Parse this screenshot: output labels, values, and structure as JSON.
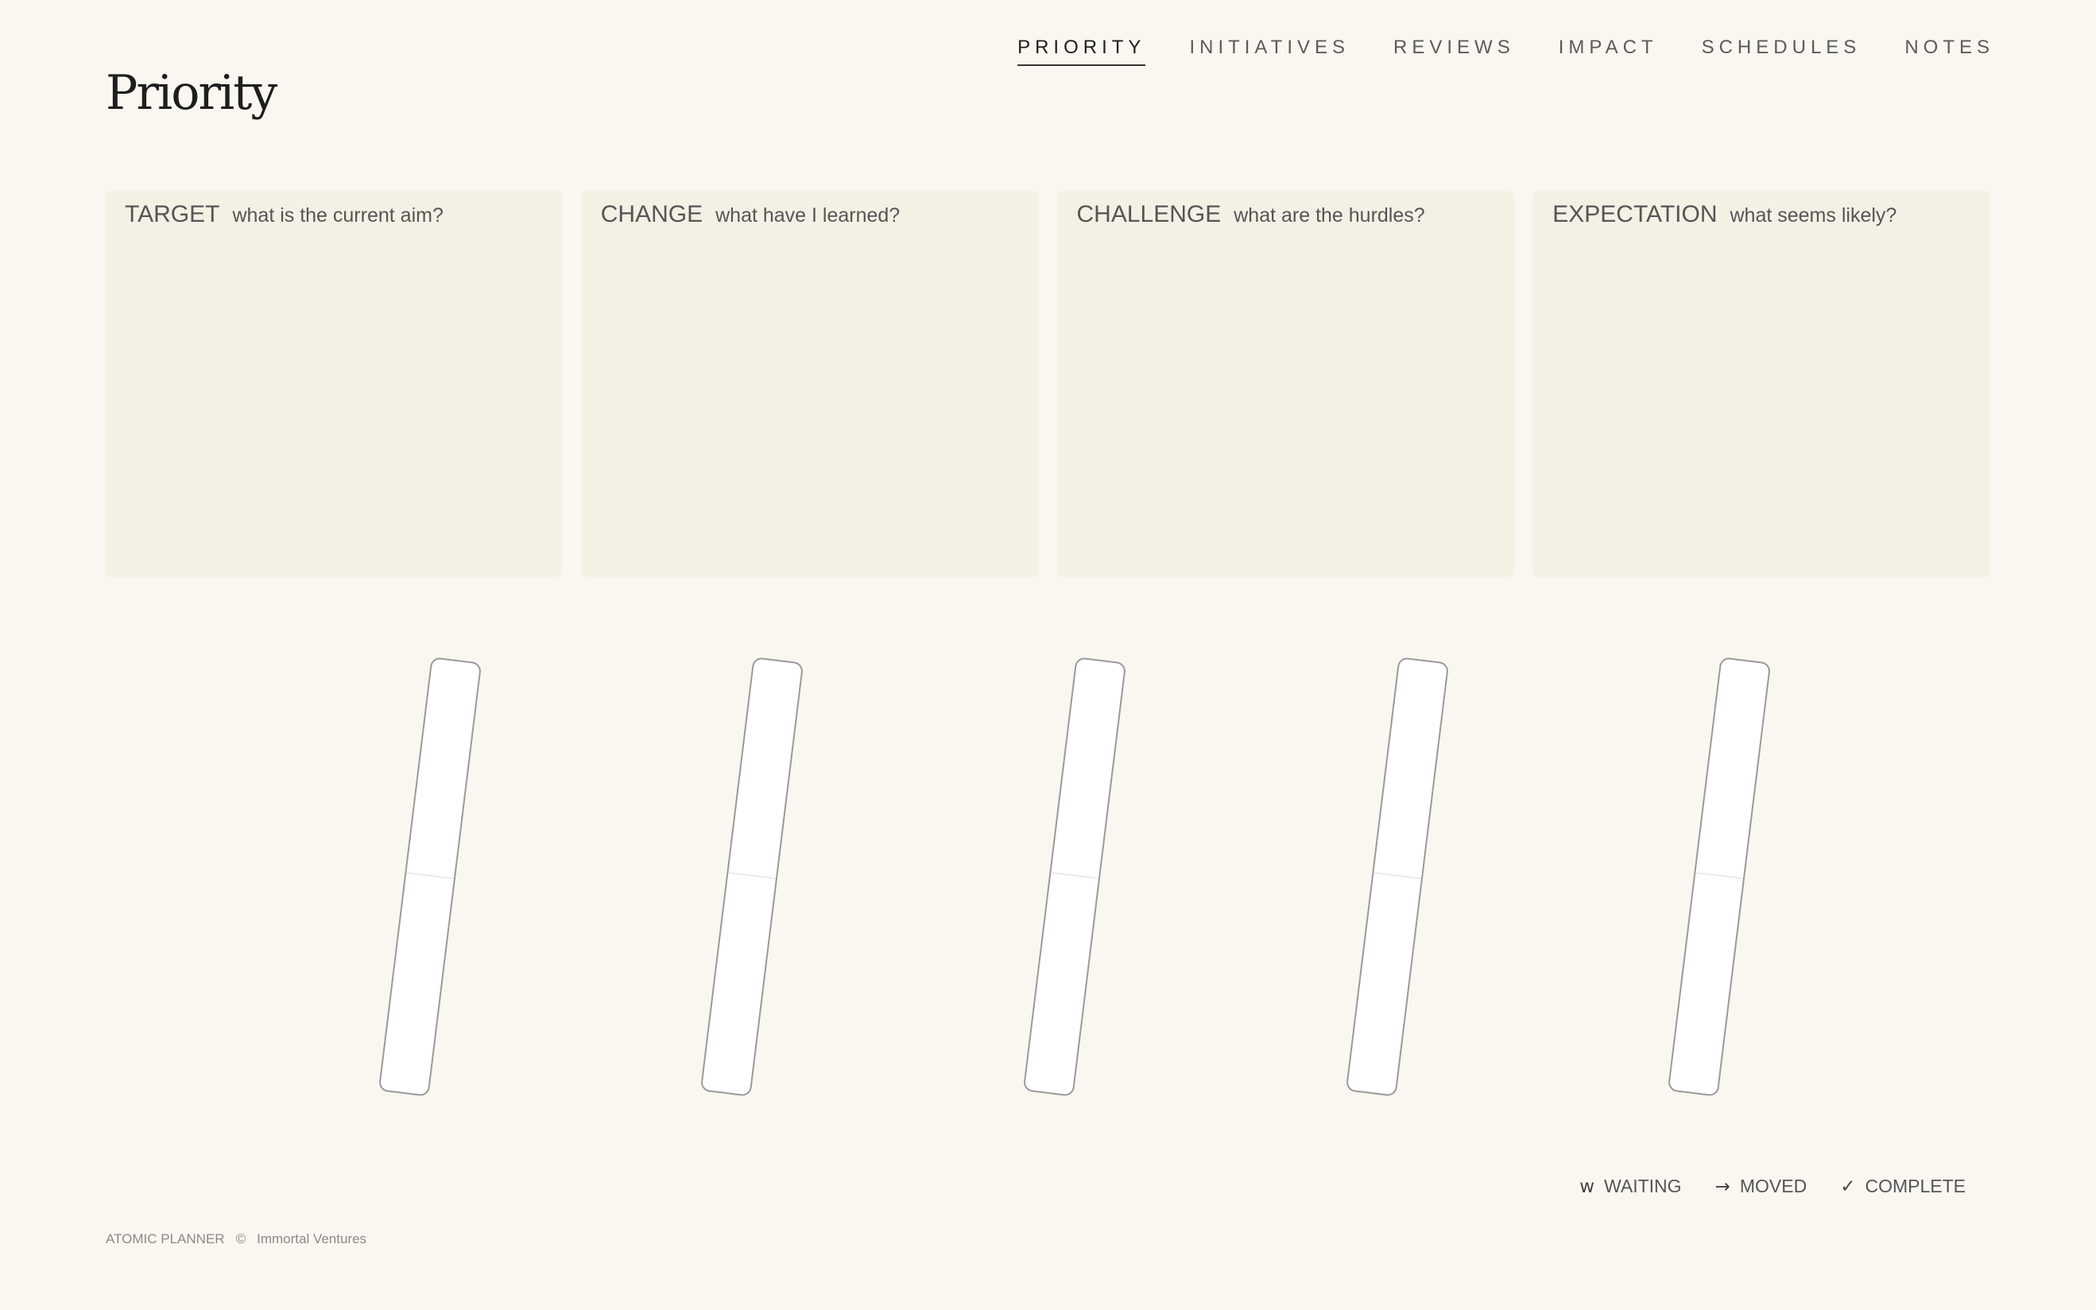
{
  "page": {
    "title": "Priority"
  },
  "nav": {
    "items": [
      {
        "label": "PRIORITY",
        "active": true
      },
      {
        "label": "INITIATIVES",
        "active": false
      },
      {
        "label": "REVIEWS",
        "active": false
      },
      {
        "label": "IMPACT",
        "active": false
      },
      {
        "label": "SCHEDULES",
        "active": false
      },
      {
        "label": "NOTES",
        "active": false
      }
    ]
  },
  "cards": [
    {
      "title": "TARGET",
      "question": "what is the current aim?"
    },
    {
      "title": "CHANGE",
      "question": "what have I learned?"
    },
    {
      "title": "CHALLENGE",
      "question": "what are the hurdles?"
    },
    {
      "title": "EXPECTATION",
      "question": "what seems likely?"
    }
  ],
  "bars": {
    "count": 5
  },
  "legend": {
    "items": [
      {
        "symbol": "w",
        "label": "WAITING",
        "icon": "waiting-icon"
      },
      {
        "symbol": "→",
        "label": "MOVED",
        "icon": "arrow-right-icon"
      },
      {
        "symbol": "✓",
        "label": "COMPLETE",
        "icon": "checkmark-icon"
      }
    ]
  },
  "footer": {
    "app_name": "ATOMIC PLANNER",
    "copyright_symbol": "©",
    "company": "Immortal Ventures"
  },
  "colors": {
    "background": "#faf7f0",
    "card_background": "#f4f0e4",
    "text": "#555555",
    "title": "#1e1e1e",
    "bar_border": "#9a9a9a",
    "bar_fill": "#ffffff"
  }
}
